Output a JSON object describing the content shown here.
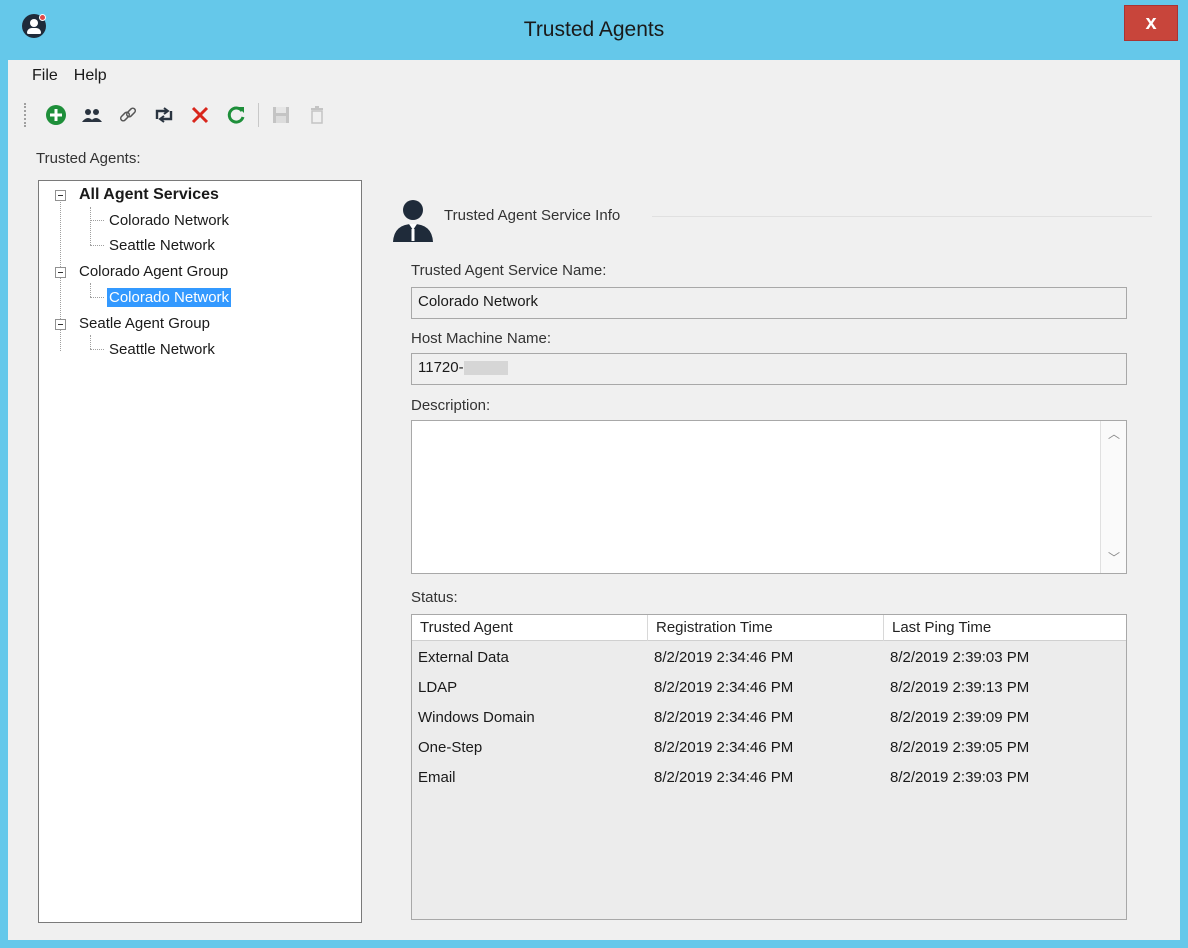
{
  "window": {
    "title": "Trusted Agents",
    "close_label": "x"
  },
  "menu": [
    "File",
    "Help"
  ],
  "toolbar": {
    "icons": [
      "add-icon",
      "group-icon",
      "link-icon",
      "retweet-icon",
      "delete-icon",
      "refresh-icon",
      "save-icon",
      "trash-icon"
    ]
  },
  "tree": {
    "label": "Trusted Agents:",
    "nodes": [
      {
        "label": "All Agent Services"
      },
      {
        "label": "Colorado Network"
      },
      {
        "label": "Seattle Network"
      },
      {
        "label": "Colorado Agent Group"
      },
      {
        "label": "Colorado Network"
      },
      {
        "label": "Seatle Agent Group"
      },
      {
        "label": "Seattle Network"
      }
    ]
  },
  "info": {
    "section_title": "Trusted Agent Service Info",
    "service_name_label": "Trusted Agent Service Name:",
    "service_name_value": "Colorado Network",
    "host_label": "Host Machine Name:",
    "host_value": "11720-",
    "description_label": "Description:",
    "description_value": "",
    "status_label": "Status:"
  },
  "status": {
    "columns": [
      "Trusted Agent",
      "Registration Time",
      "Last Ping Time"
    ],
    "rows": [
      [
        "External Data",
        "8/2/2019 2:34:46 PM",
        "8/2/2019 2:39:03 PM"
      ],
      [
        "LDAP",
        "8/2/2019 2:34:46 PM",
        "8/2/2019 2:39:13 PM"
      ],
      [
        "Windows Domain",
        "8/2/2019 2:34:46 PM",
        "8/2/2019 2:39:09 PM"
      ],
      [
        "One-Step",
        "8/2/2019 2:34:46 PM",
        "8/2/2019 2:39:05 PM"
      ],
      [
        "Email",
        "8/2/2019 2:34:46 PM",
        "8/2/2019 2:39:03 PM"
      ]
    ]
  }
}
